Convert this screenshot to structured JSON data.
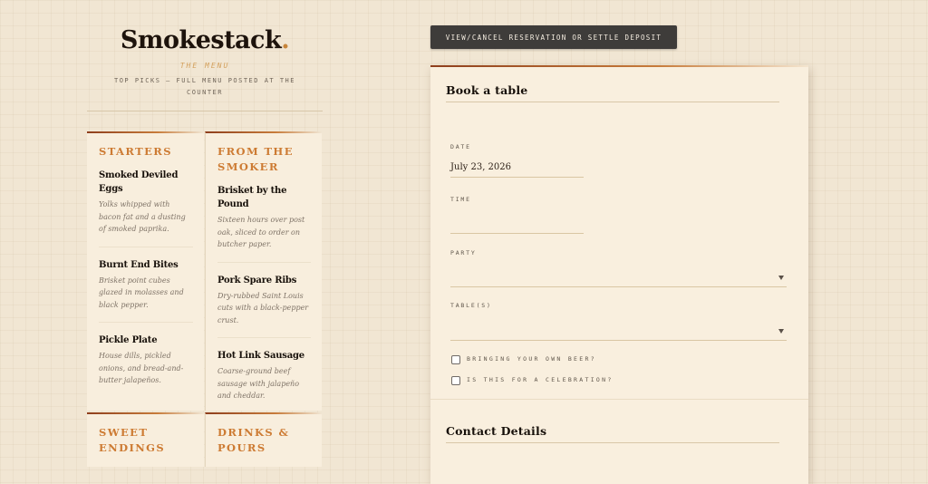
{
  "brand": {
    "name": "Smokestack",
    "dot": ".",
    "eyebrow": "THE MENU",
    "subtitle": "TOP PICKS — FULL MENU POSTED AT THE COUNTER"
  },
  "menu": {
    "starters": {
      "title": "STARTERS",
      "items": [
        {
          "name": "Smoked Deviled Eggs",
          "desc": "Yolks whipped with bacon fat and a dusting of smoked paprika."
        },
        {
          "name": "Burnt End Bites",
          "desc": "Brisket point cubes glazed in molasses and black pepper."
        },
        {
          "name": "Pickle Plate",
          "desc": "House dills, pickled onions, and bread-and-butter jalapeños."
        }
      ]
    },
    "smoker": {
      "title": "FROM THE SMOKER",
      "items": [
        {
          "name": "Brisket by the Pound",
          "desc": "Sixteen hours over post oak, sliced to order on butcher paper."
        },
        {
          "name": "Pork Spare Ribs",
          "desc": "Dry-rubbed Saint Louis cuts with a black-pepper crust."
        },
        {
          "name": "Hot Link Sausage",
          "desc": "Coarse-ground beef sausage with jalapeño and cheddar."
        }
      ]
    },
    "sweet": {
      "title": "SWEET ENDINGS"
    },
    "drinks": {
      "title": "DRINKS & POURS"
    }
  },
  "reservation_button": {
    "label": "VIEW/CANCEL RESERVATION OR SETTLE DEPOSIT"
  },
  "booking": {
    "heading": "Book a table",
    "date_label": "DATE",
    "date_value": "July 23, 2026",
    "time_label": "TIME",
    "time_value": "",
    "party_label": "PARTY",
    "party_value": "",
    "tables_label": "TABLE(S)",
    "tables_value": "",
    "byob_label": "BRINGING YOUR OWN BEER?",
    "celebration_label": "IS THIS FOR A CELEBRATION?"
  },
  "contact": {
    "heading": "Contact Details"
  }
}
